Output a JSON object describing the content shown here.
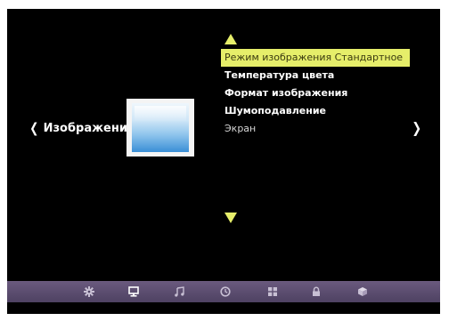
{
  "category": {
    "prev_chevron": "❮",
    "current_label": "Изображение",
    "next_chevron": "❯"
  },
  "menu": {
    "items": [
      {
        "label": "Режим изображения Стандартное",
        "selected": true
      },
      {
        "label": "Температура цвета",
        "selected": false
      },
      {
        "label": "Формат изображения",
        "selected": false
      },
      {
        "label": "Шумоподавление",
        "selected": false
      },
      {
        "label": "Экран",
        "selected": false
      }
    ]
  },
  "bottom_bar": {
    "icons": [
      "settings-gear-icon",
      "picture-monitor-icon",
      "sound-note-icon",
      "time-clock-icon",
      "channels-grid-icon",
      "lock-icon",
      "box-icon"
    ],
    "active_icon": "picture-monitor-icon"
  },
  "colors": {
    "highlight": "#e6ee6a",
    "screen_bg": "#000000",
    "bar_bg": "#5a4d6e",
    "icon_light": "#ffffff",
    "icon_dim": "#c8c0d4"
  }
}
